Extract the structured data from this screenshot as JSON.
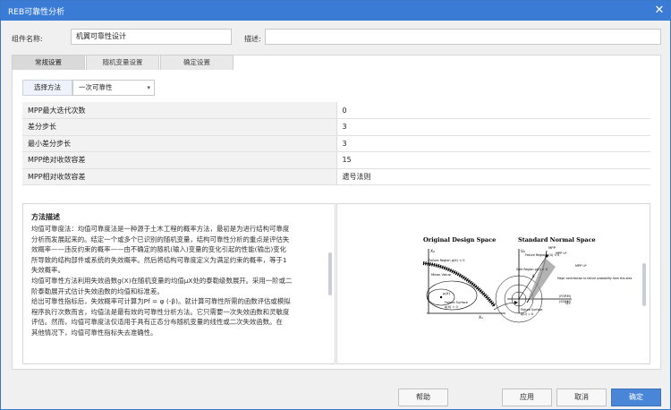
{
  "window": {
    "title": "REB可靠性分析"
  },
  "component": {
    "name_label": "组件名称:",
    "name_value": "机翼可靠性设计",
    "desc_label": "描述:",
    "desc_value": ""
  },
  "tabs": [
    {
      "label": "常规设置",
      "active": true
    },
    {
      "label": "随机变量设置",
      "active": false
    },
    {
      "label": "确定设置",
      "active": false
    }
  ],
  "method": {
    "label": "选择方法",
    "value": "一次可靠性"
  },
  "params": [
    {
      "name": "MPP最大迭代次数",
      "value": "0"
    },
    {
      "name": "差分步长",
      "value": "3"
    },
    {
      "name": "最小差分步长",
      "value": "3"
    },
    {
      "name": "MPP绝对收敛容差",
      "value": "15"
    },
    {
      "name": "MPP相对收敛容差",
      "value": "遗号法则"
    }
  ],
  "description": {
    "heading": "方法描述",
    "lines": [
      "均值可靠度法：均值可靠度法是一种源于土木工程的概率方法，最初是为进行结构可靠度",
      "分析而发展起来的。结定一个或多个已识别的随机变量，结构可靠性分析的重点是评估失",
      "效概率——违反约束的概率——由不确定的随机(输入)变量的变化引起的性能(输出)变化",
      "所导致的结构部件或系统的失效概率。然后将结构可靠度定义为满足约束的概率，等于1",
      "失效概率。",
      "均值可靠性方法利用失效函数g(X)在随机变量的均值μX处的泰勒级数展开。采用一阶或二",
      "阶泰勒展开式估计失效函数的均值和标准差。",
      "给出可靠性指标后，失效概率可计算为Pf = φ (-β)。就计算可靠性所需的函数评估或模拟",
      "程序执行次数而言，均值法是最有效的可靠性分析方法。它只需要一次失效函数和灵敏度",
      "评估。然而，均值可靠度法仅适用于具有正态分布随机变量的线性或二次失效函数。在",
      "其他情况下，均值可靠性指标失去准确性。"
    ]
  },
  "figure": {
    "left_title": "Original Design Space",
    "right_title": "Standard Normal Space",
    "labels": {
      "x2": "X₂",
      "x1": "X₁",
      "u2": "U₂",
      "u1": "U₁",
      "mean_value": "Mean Value",
      "mu_x": "μ(X)",
      "failure_surface": "Failure Surface",
      "gx0": "g(X) = 0",
      "failure_region_x": "Failure Region g(X) < 0",
      "safe_region": "Safe Region g(U) > 0",
      "failure_region_u": "Failure Region g(U) < 0",
      "failure_surface_u": "Failure Surface",
      "gu0": "g(U) = 0",
      "mpp": "MPP",
      "mpp_u": "MPP U*",
      "mpp_u2": "MPP U*",
      "beta": "β",
      "major": "Major contribution to failure probability from this area",
      "form": "(FORM)",
      "sorm": "(SORM)"
    }
  },
  "buttons": {
    "help": "帮助",
    "apply": "应用",
    "cancel": "取消",
    "ok": "确定"
  }
}
